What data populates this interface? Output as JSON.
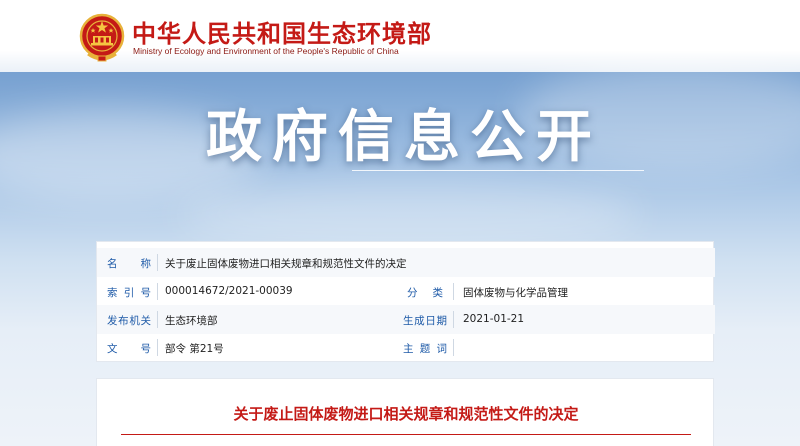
{
  "header": {
    "title": "中华人民共和国生态环境部",
    "subtitle": "Ministry of Ecology and Environment of the People's Republic of China",
    "emblem_icon": "national-emblem-icon"
  },
  "banner": {
    "title": "政府信息公开"
  },
  "info": {
    "name_label": "名　称",
    "name_value": "关于废止固体废物进口相关规章和规范性文件的决定",
    "index_label": "索引号",
    "index_value": "000014672/2021-00039",
    "category_label": "分类",
    "category_value": "固体废物与化学品管理",
    "issuer_label": "发布机关",
    "issuer_value": "生态环境部",
    "date_label": "生成日期",
    "date_value": "2021-01-21",
    "docno_label": "文号",
    "docno_value": "部令 第21号",
    "subject_label": "主题词",
    "subject_value": ""
  },
  "document": {
    "title": "关于废止固体废物进口相关规章和规范性文件的决定"
  },
  "colors": {
    "brand_red": "#c41a16",
    "label_blue": "#1f5ba8"
  }
}
